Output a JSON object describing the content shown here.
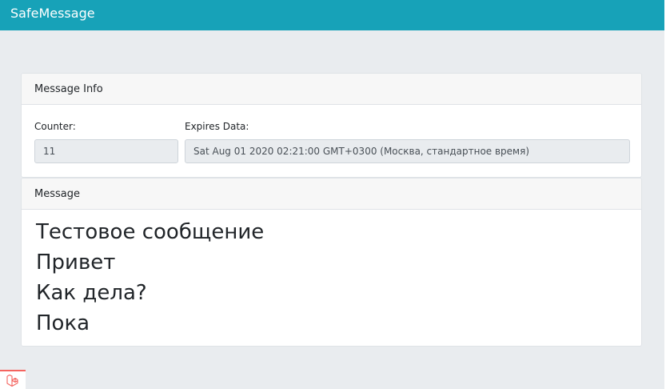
{
  "app": {
    "brand": "SafeMessage"
  },
  "message_info": {
    "header": "Message Info",
    "counter_label": "Counter:",
    "counter_value": "11",
    "expires_label": "Expires Data:",
    "expires_value": "Sat Aug 01 2020 02:21:00 GMT+0300 (Москва, стандартное время)"
  },
  "message": {
    "header": "Message",
    "lines": [
      "Тестовое сообщение",
      "Привет",
      "Как дела?",
      "Пока"
    ]
  },
  "icons": {
    "debugbar": "laravel-icon"
  },
  "colors": {
    "navbar": "#17a2b8",
    "accent": "#f4645f"
  }
}
